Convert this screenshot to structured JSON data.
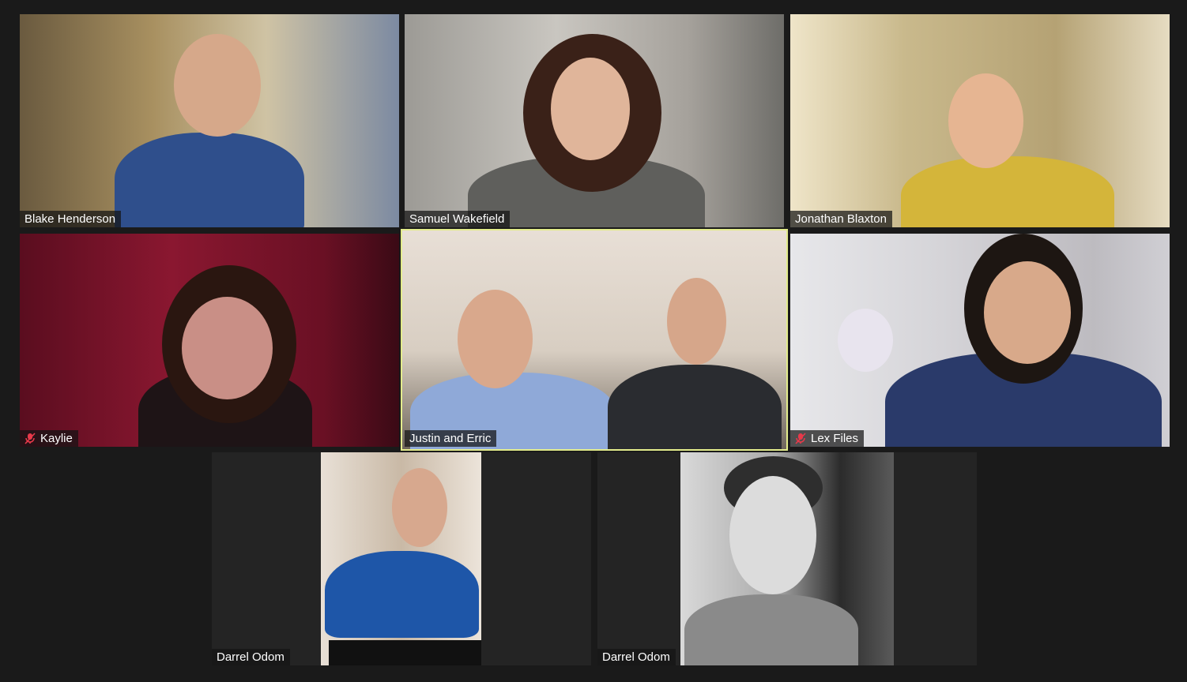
{
  "participants": [
    {
      "name": "Blake Henderson",
      "muted": false,
      "active": false
    },
    {
      "name": "Samuel Wakefield",
      "muted": false,
      "active": false
    },
    {
      "name": "Jonathan Blaxton",
      "muted": false,
      "active": false
    },
    {
      "name": "Kaylie",
      "muted": true,
      "active": false
    },
    {
      "name": "Justin and Erric",
      "muted": false,
      "active": true
    },
    {
      "name": "Lex Files",
      "muted": true,
      "active": false
    },
    {
      "name": "Darrel Odom",
      "muted": false,
      "active": false
    },
    {
      "name": "Darrel Odom",
      "muted": false,
      "active": false
    }
  ],
  "colors": {
    "background": "#1a1a1a",
    "tile_background": "#242424",
    "active_speaker_border": "#e3ec8c",
    "muted_icon": "#e8394a"
  },
  "icons": {
    "muted": "mic-muted-icon"
  }
}
